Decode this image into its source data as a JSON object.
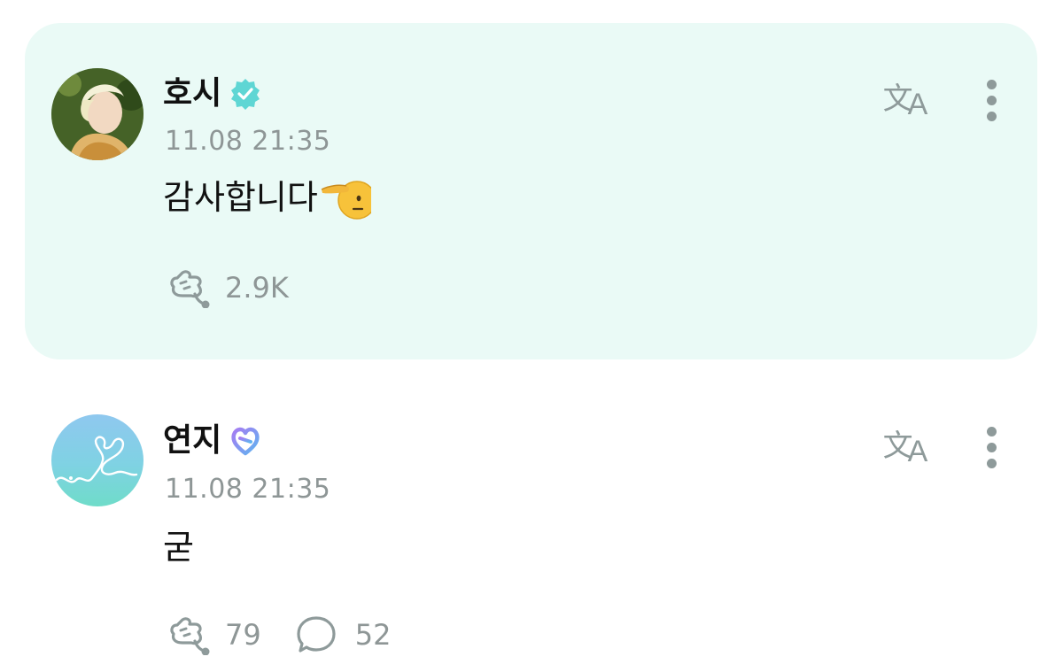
{
  "posts": [
    {
      "author": "호시",
      "verified_badge": "teal-check-badge",
      "badge_color": "#5fd6d4",
      "timestamp": "11.08 21:35",
      "text": "감사합니다",
      "emoji": "saluting-face-emoji",
      "likes": "2.9K",
      "highlighted": true,
      "background_color": "#eafaf6"
    },
    {
      "author": "연지",
      "verified_badge": "purple-heart-link-badge",
      "badge_color": "#8e7cf0",
      "timestamp": "11.08 21:35",
      "text": "굳",
      "likes": "79",
      "comments": "52",
      "highlighted": false
    }
  ],
  "icons": {
    "translate": "translate-icon",
    "more": "more-vertical-icon",
    "like": "cheer-fist-icon",
    "comment": "speech-bubble-icon"
  }
}
